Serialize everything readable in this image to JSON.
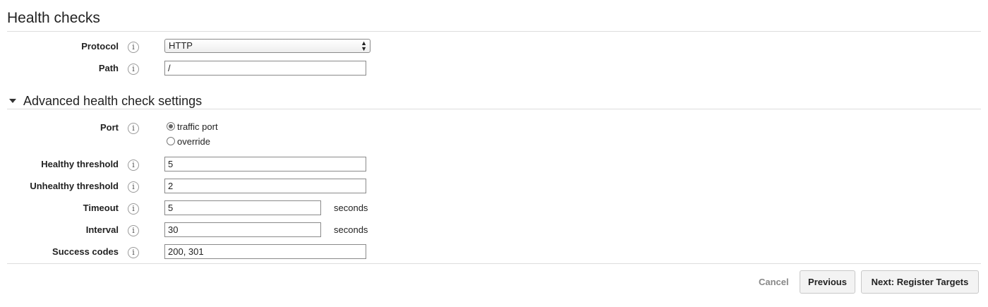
{
  "section": {
    "title": "Health checks"
  },
  "advanced": {
    "title": "Advanced health check settings"
  },
  "fields": {
    "protocol": {
      "label": "Protocol",
      "value": "HTTP"
    },
    "path": {
      "label": "Path",
      "value": "/"
    },
    "port": {
      "label": "Port",
      "options": [
        "traffic port",
        "override"
      ],
      "selected": "traffic port"
    },
    "healthy_threshold": {
      "label": "Healthy threshold",
      "value": "5"
    },
    "unhealthy_threshold": {
      "label": "Unhealthy threshold",
      "value": "2"
    },
    "timeout": {
      "label": "Timeout",
      "value": "5",
      "suffix": "seconds"
    },
    "interval": {
      "label": "Interval",
      "value": "30",
      "suffix": "seconds"
    },
    "success_codes": {
      "label": "Success codes",
      "value": "200, 301"
    }
  },
  "info_icon": {
    "glyph": "i",
    "name": "info-icon"
  },
  "buttons": {
    "cancel": "Cancel",
    "previous": "Previous",
    "next": "Next: Register Targets"
  }
}
